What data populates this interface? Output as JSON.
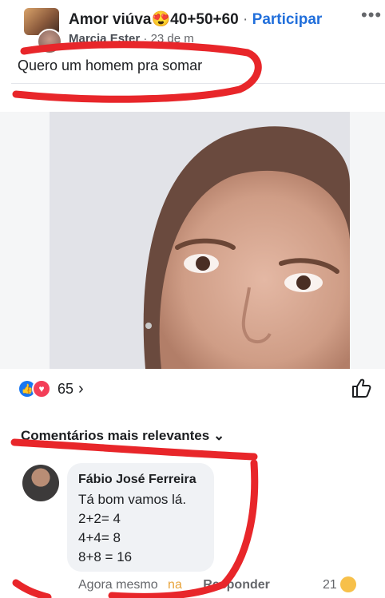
{
  "post": {
    "group_name": "Amor viúva",
    "group_tag": "40+50+60",
    "separator": "·",
    "join_label": "Participar",
    "more_label": "•••",
    "author": "Marcia Ester",
    "date": "23 de m",
    "text": "Quero um homem pra somar",
    "photo_alt": "selfie photo"
  },
  "reactions": {
    "count": "65",
    "chevron": "›",
    "like_emoji_icon": "like-icon",
    "love_emoji_icon": "heart-icon"
  },
  "comments": {
    "sort_label": "Comentários mais relevantes",
    "sort_chevron": "⌄",
    "items": [
      {
        "author": "Fábio José Ferreira",
        "lines": [
          "Tá bom vamos lá.",
          "2+2= 4",
          "4+4= 8",
          "8+8 = 16"
        ],
        "time": "Agora mesmo",
        "like_label": "na",
        "reply_label": "Responder",
        "reaction_count": "21"
      }
    ]
  },
  "colors": {
    "accent": "#216fdb",
    "annotation": "#e8262a"
  }
}
